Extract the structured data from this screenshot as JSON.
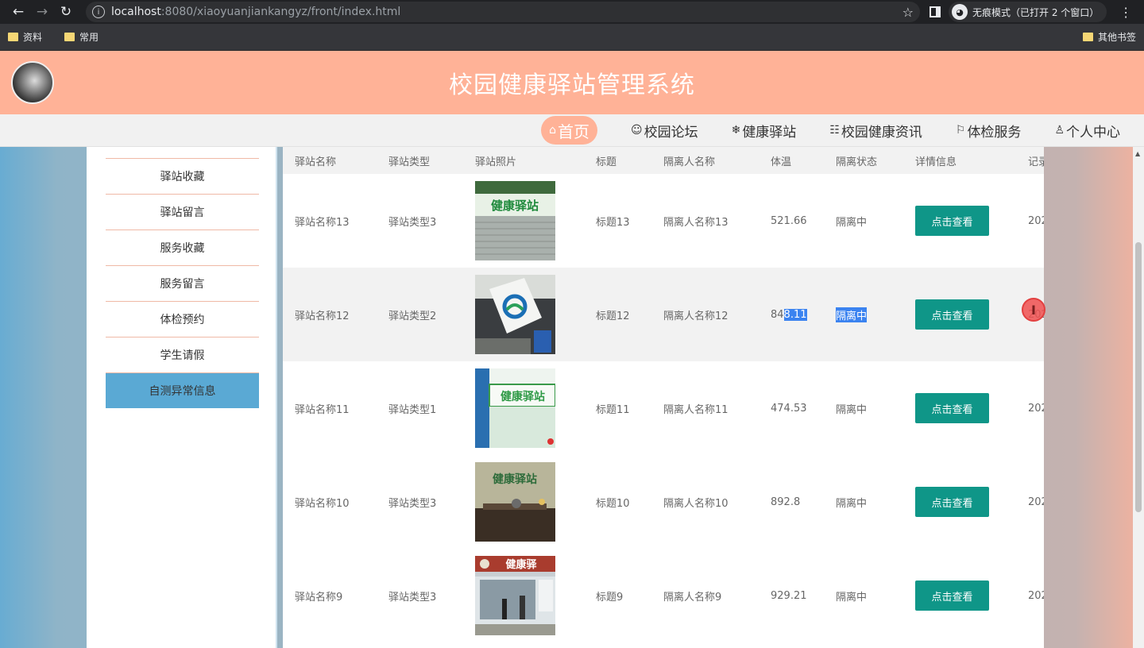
{
  "browser": {
    "url_host": "localhost",
    "url_path": ":8080/xiaoyuanjiankangyz/front/index.html",
    "incognito_label": "无痕模式（已打开 2 个窗口）",
    "bookmarks": [
      "资料",
      "常用"
    ],
    "other_bookmarks": "其他书签"
  },
  "header": {
    "title": "校园健康驿站管理系统"
  },
  "nav": {
    "items": [
      {
        "icon": "⌂",
        "label": "首页"
      },
      {
        "icon": "☺",
        "label": "校园论坛"
      },
      {
        "icon": "❄",
        "label": "健康驿站"
      },
      {
        "icon": "☷",
        "label": "校园健康资讯"
      },
      {
        "icon": "⚐",
        "label": "体检服务"
      },
      {
        "icon": "♙",
        "label": "个人中心"
      }
    ]
  },
  "sidebar": {
    "items": [
      {
        "label": "驿站收藏"
      },
      {
        "label": "驿站留言"
      },
      {
        "label": "服务收藏"
      },
      {
        "label": "服务留言"
      },
      {
        "label": "体检预约"
      },
      {
        "label": "学生请假"
      },
      {
        "label": "自测异常信息"
      }
    ]
  },
  "table": {
    "headers": [
      "驿站名称",
      "驿站类型",
      "驿站照片",
      "标题",
      "隔离人名称",
      "体温",
      "隔离状态",
      "详情信息",
      "记录"
    ],
    "button_label": "点击查看",
    "rows": [
      {
        "name": "驿站名称13",
        "type": "驿站类型3",
        "photo": "健康驿站",
        "title": "标题13",
        "person": "隔离人名称13",
        "temp": "521.66",
        "status": "隔离中",
        "record": "202"
      },
      {
        "name": "驿站名称12",
        "type": "驿站类型2",
        "photo": "logo-sign",
        "title": "标题12",
        "person": "隔离人名称12",
        "temp_a": "84",
        "temp_b": "8.11",
        "status": "隔离中",
        "record": "202"
      },
      {
        "name": "驿站名称11",
        "type": "驿站类型1",
        "photo": "健康驿站",
        "title": "标题11",
        "person": "隔离人名称11",
        "temp": "474.53",
        "status": "隔离中",
        "record": "202"
      },
      {
        "name": "驿站名称10",
        "type": "驿站类型3",
        "photo": "健康驿站",
        "title": "标题10",
        "person": "隔离人名称10",
        "temp": "892.8",
        "status": "隔离中",
        "record": "202"
      },
      {
        "name": "驿站名称9",
        "type": "驿站类型3",
        "photo": "健康驿",
        "title": "标题9",
        "person": "隔离人名称9",
        "temp": "929.21",
        "status": "隔离中",
        "record": "202"
      }
    ]
  },
  "colors": {
    "header_bg": "#ffb297",
    "button_bg": "#0f9688",
    "sidebar_active": "#5aa9d4"
  }
}
